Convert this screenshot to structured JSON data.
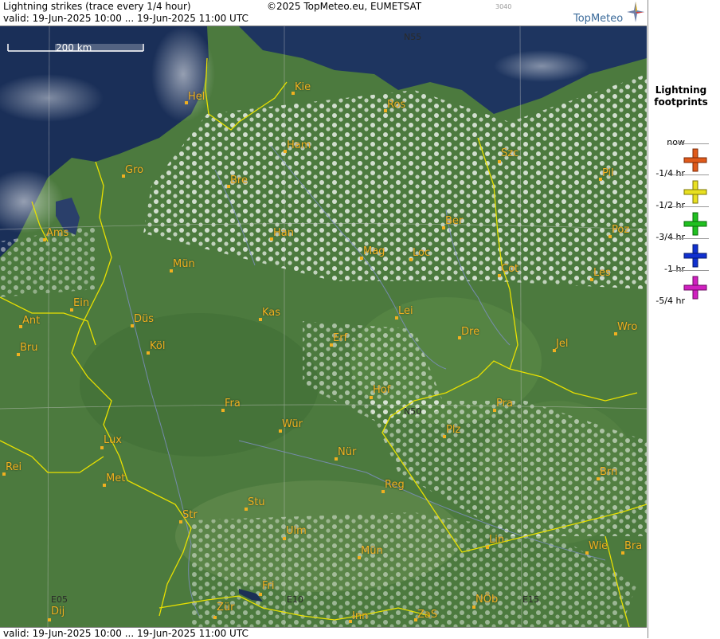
{
  "header": {
    "title": "Lightning strikes (trace every 1/4 hour)",
    "valid": "valid:  19-Jun-2025 10:00 ... 19-Jun-2025 11:00 UTC",
    "copyright": "©2025 TopMeteo.eu, EUMETSAT",
    "code": "3040",
    "logo": "TopMeteo"
  },
  "footer": {
    "valid": "valid:  19-Jun-2025 10:00 ... 19-Jun-2025 11:00 UTC"
  },
  "scale_label": "200 km",
  "legend": {
    "title": "Lightning footprints",
    "entries": [
      {
        "label": "now"
      },
      {
        "label": "-1/4 hr",
        "color": "#e05a1a"
      },
      {
        "label": "-1/2 hr",
        "color": "#e8e020"
      },
      {
        "label": "-3/4 hr",
        "color": "#20c020"
      },
      {
        "label": "-1 hr",
        "color": "#1030d0"
      },
      {
        "label": "-5/4 hr",
        "color": "#d020c0"
      }
    ]
  },
  "grid_labels": {
    "n55": "N55",
    "n50": "N50",
    "e05": "E05",
    "e10": "E10",
    "e15": "E15"
  },
  "cities": [
    {
      "id": "hel",
      "name": "Hel"
    },
    {
      "id": "kie",
      "name": "Kie"
    },
    {
      "id": "ros",
      "name": "Ros"
    },
    {
      "id": "ham",
      "name": "Ham"
    },
    {
      "id": "szc",
      "name": "Szc"
    },
    {
      "id": "gro",
      "name": "Gro"
    },
    {
      "id": "bre",
      "name": "Bre"
    },
    {
      "id": "pil",
      "name": "Pil"
    },
    {
      "id": "ber",
      "name": "Ber"
    },
    {
      "id": "ams",
      "name": "Ams"
    },
    {
      "id": "han",
      "name": "Han"
    },
    {
      "id": "poz",
      "name": "Poz"
    },
    {
      "id": "mag",
      "name": "Mag"
    },
    {
      "id": "loc",
      "name": "Loc"
    },
    {
      "id": "mun",
      "name": "Mün"
    },
    {
      "id": "cot",
      "name": "Cot"
    },
    {
      "id": "les",
      "name": "Les"
    },
    {
      "id": "ein",
      "name": "Ein"
    },
    {
      "id": "kas",
      "name": "Kas"
    },
    {
      "id": "lei",
      "name": "Lei"
    },
    {
      "id": "ant",
      "name": "Ant"
    },
    {
      "id": "dus",
      "name": "Düs"
    },
    {
      "id": "wro",
      "name": "Wro"
    },
    {
      "id": "dre",
      "name": "Dre"
    },
    {
      "id": "erf",
      "name": "Erf"
    },
    {
      "id": "bru",
      "name": "Bru"
    },
    {
      "id": "kol",
      "name": "Köl"
    },
    {
      "id": "jel",
      "name": "Jel"
    },
    {
      "id": "hof",
      "name": "Hof"
    },
    {
      "id": "fra",
      "name": "Fra"
    },
    {
      "id": "pra",
      "name": "Pra"
    },
    {
      "id": "wur",
      "name": "Wür"
    },
    {
      "id": "plz",
      "name": "Plz"
    },
    {
      "id": "lux",
      "name": "Lux"
    },
    {
      "id": "nur",
      "name": "Nür"
    },
    {
      "id": "rei",
      "name": "Rei"
    },
    {
      "id": "brn",
      "name": "Brn"
    },
    {
      "id": "met",
      "name": "Met"
    },
    {
      "id": "reg",
      "name": "Reg"
    },
    {
      "id": "stu",
      "name": "Stu"
    },
    {
      "id": "str",
      "name": "Str"
    },
    {
      "id": "ulm",
      "name": "Ulm"
    },
    {
      "id": "lin",
      "name": "Lin"
    },
    {
      "id": "munich",
      "name": "Mün"
    },
    {
      "id": "wie",
      "name": "Wie"
    },
    {
      "id": "bra",
      "name": "Bra"
    },
    {
      "id": "fri",
      "name": "Fri"
    },
    {
      "id": "nob",
      "name": "NÖb"
    },
    {
      "id": "dij",
      "name": "Dij"
    },
    {
      "id": "zur",
      "name": "Zür"
    },
    {
      "id": "inn",
      "name": "Inn"
    },
    {
      "id": "zas",
      "name": "ZaS"
    }
  ]
}
